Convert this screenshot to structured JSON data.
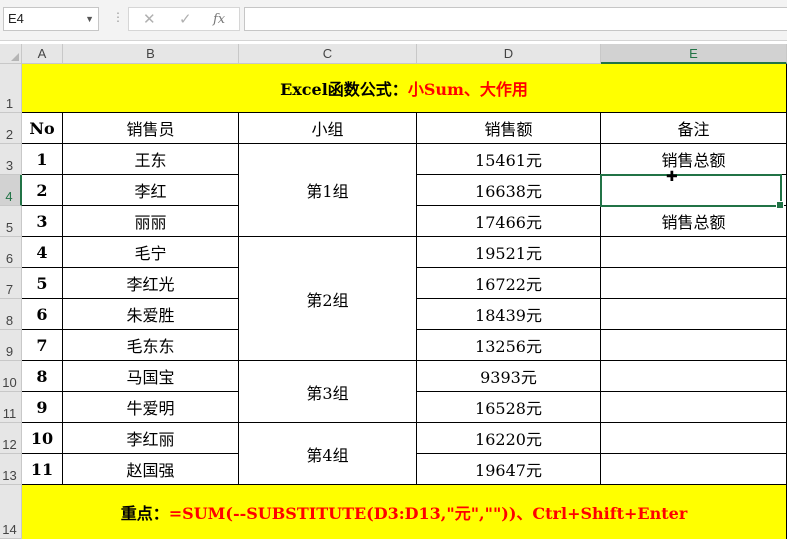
{
  "formula_bar": {
    "name_box": "E4",
    "cancel_icon": "✕",
    "enter_icon": "✓",
    "fx_label": "fx",
    "formula": ""
  },
  "columns": [
    "A",
    "B",
    "C",
    "D",
    "E"
  ],
  "rows": [
    "1",
    "2",
    "3",
    "4",
    "5",
    "6",
    "7",
    "8",
    "9",
    "10",
    "11",
    "12",
    "13",
    "14"
  ],
  "title": {
    "part1": "Excel函数公式：",
    "part2": "小Sum、大作用"
  },
  "headers": {
    "no": "No",
    "salesperson": "销售员",
    "group": "小组",
    "sales": "销售额",
    "note": "备注"
  },
  "records": [
    {
      "no": "1",
      "name": "王东",
      "sales": "15461元",
      "note": "销售总额"
    },
    {
      "no": "2",
      "name": "李红",
      "sales": "16638元",
      "note": ""
    },
    {
      "no": "3",
      "name": "丽丽",
      "sales": "17466元",
      "note": "销售总额"
    },
    {
      "no": "4",
      "name": "毛宁",
      "sales": "19521元",
      "note": ""
    },
    {
      "no": "5",
      "name": "李红光",
      "sales": "16722元",
      "note": ""
    },
    {
      "no": "6",
      "name": "朱爱胜",
      "sales": "18439元",
      "note": ""
    },
    {
      "no": "7",
      "name": "毛东东",
      "sales": "13256元",
      "note": ""
    },
    {
      "no": "8",
      "name": "马国宝",
      "sales": "9393元",
      "note": ""
    },
    {
      "no": "9",
      "name": "牛爱明",
      "sales": "16528元",
      "note": ""
    },
    {
      "no": "10",
      "name": "李红丽",
      "sales": "16220元",
      "note": ""
    },
    {
      "no": "11",
      "name": "赵国强",
      "sales": "19647元",
      "note": ""
    }
  ],
  "groups": [
    "第1组",
    "第2组",
    "第3组",
    "第4组"
  ],
  "footer": {
    "part1": "重点：",
    "part2": "=SUM(--SUBSTITUTE(D3:D13,\"元\",\"\"))、Ctrl+Shift+Enter"
  },
  "colors": {
    "highlight": "#ffff00",
    "accent_red": "#ff0000",
    "selection": "#217346"
  }
}
